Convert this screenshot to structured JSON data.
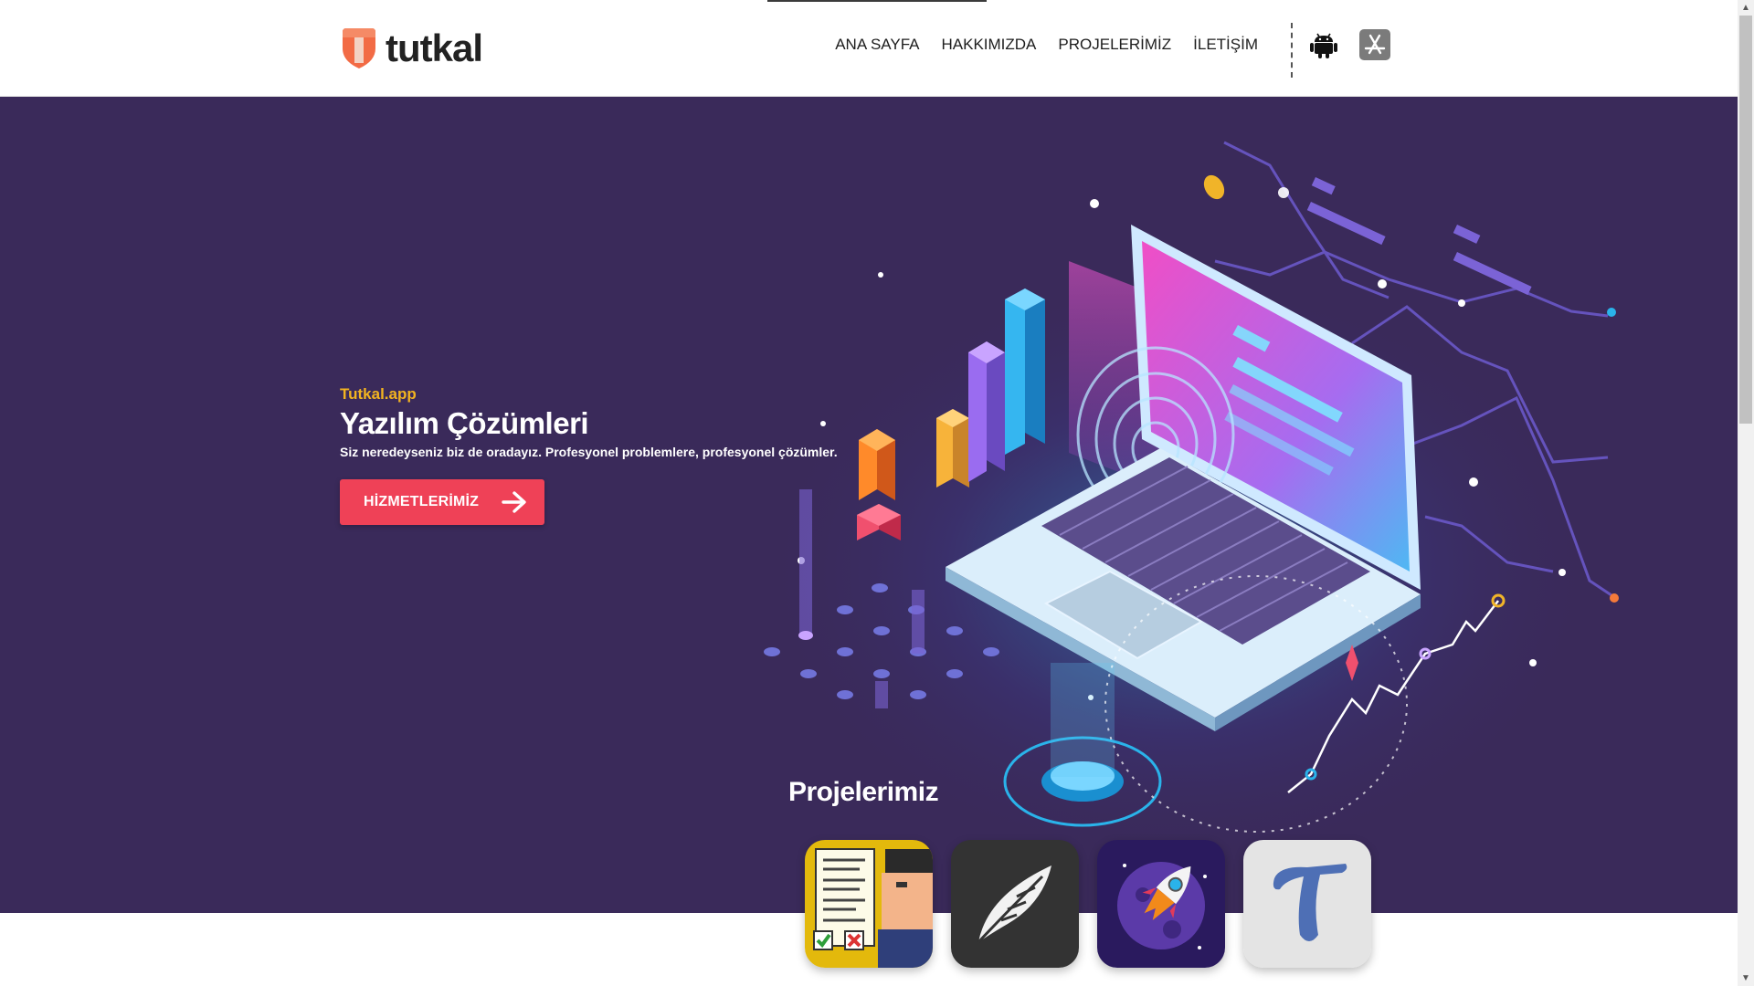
{
  "header": {
    "logo_text": "tutkal",
    "nav": [
      "ANA SAYFA",
      "HAKKIMIZDA",
      "PROJELERİMİZ",
      "İLETİŞİM"
    ],
    "store_icons": [
      "android-icon",
      "app-store-icon"
    ]
  },
  "hero": {
    "eyebrow": "Tutkal.app",
    "title": "Yazılım Çözümleri",
    "subtitle": "Siz neredeyseniz biz de oradayız. Profesyonel problemlere, profesyonel çözümler.",
    "cta_label": "HİZMETLERİMİZ"
  },
  "projects": {
    "title": "Projelerimiz",
    "tiles": [
      "checklist-app-icon",
      "feather-app-icon",
      "rocket-app-icon",
      "letter-t-app-icon"
    ]
  },
  "colors": {
    "hero_bg": "#3a2a5a",
    "accent": "#ef4157",
    "eyebrow": "#f2b320",
    "logo_orange": "#f26b45"
  }
}
